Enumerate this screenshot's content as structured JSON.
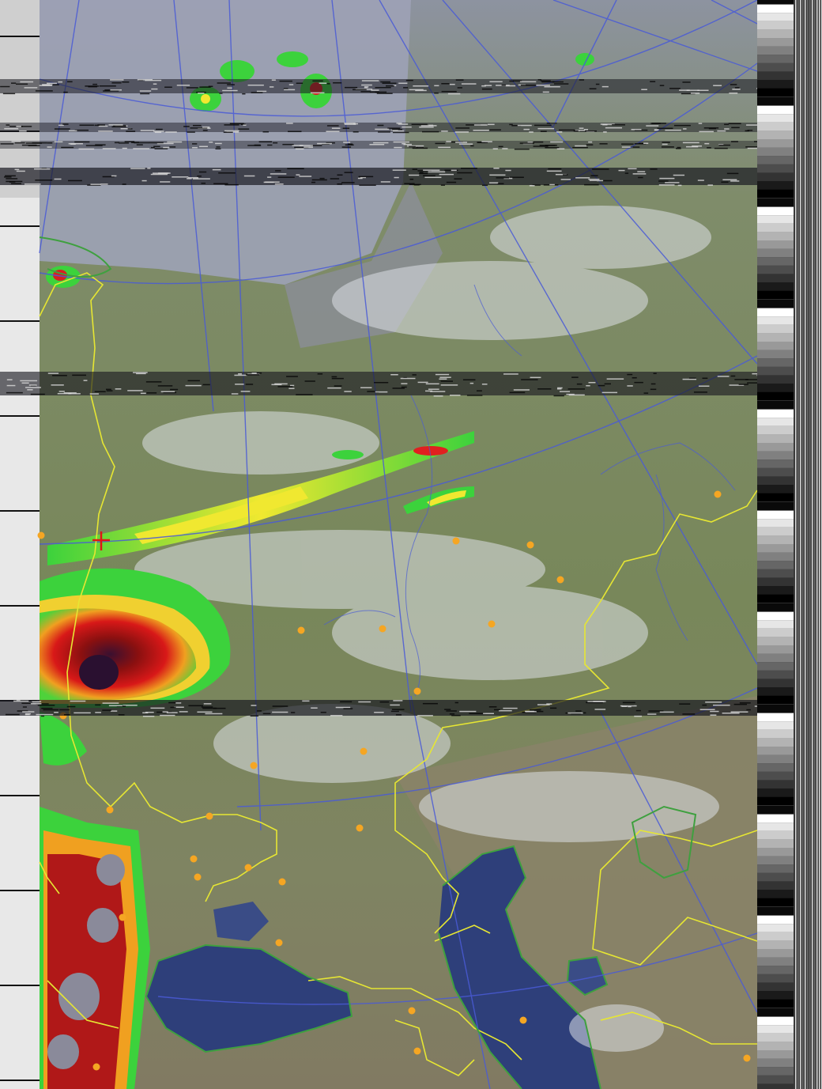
{
  "image": {
    "kind": "satellite-weather-image",
    "colors": {
      "land": "#7d8a5a",
      "land_dark": "#6b7452",
      "steppe": "#8a8a6e",
      "water": "#2e3f7a",
      "cloud": "#d8dbe0",
      "graticule": "#4a5bd6",
      "coastline": "#3fa03f",
      "border": "#e6e633",
      "city": "#f5a623",
      "storm_core": "#8a1010",
      "storm_mid": "#e02020",
      "storm_yellow": "#ffe82a",
      "storm_green": "#3cd23c",
      "noise": "#101010",
      "marker": "#e01515"
    }
  }
}
